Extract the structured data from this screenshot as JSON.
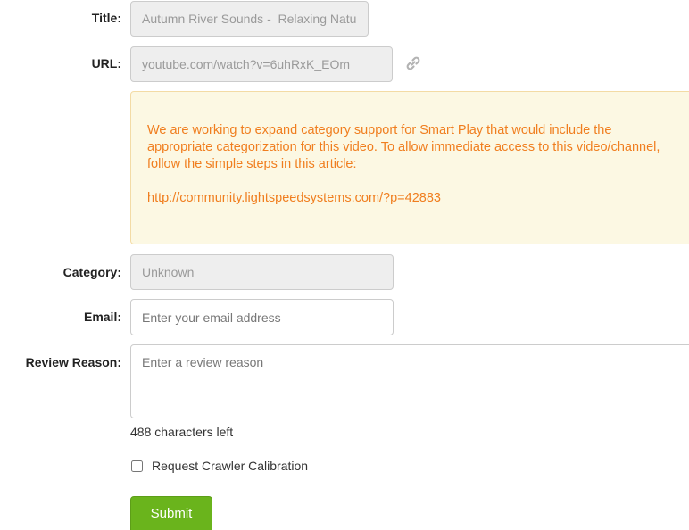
{
  "form": {
    "title_label": "Title:",
    "title_value": "Autumn River Sounds -  Relaxing Natu",
    "url_label": "URL:",
    "url_value": "youtube.com/watch?v=6uhRxK_EOm",
    "link_icon": "link-icon",
    "notice": {
      "text": "We are working to expand category support for Smart Play that would include the appropriate categorization for this video. To allow immediate access to this video/channel, follow the simple steps in this article:",
      "link": "http://community.lightspeedsystems.com/?p=42883"
    },
    "category_label": "Category:",
    "category_value": "Unknown",
    "email_label": "Email:",
    "email_placeholder": "Enter your email address",
    "reason_label": "Review Reason:",
    "reason_placeholder": "Enter a review reason",
    "characters_left": "488 characters left",
    "crawler_label": "Request Crawler Calibration",
    "crawler_checked": false,
    "submit_label": "Submit"
  },
  "colors": {
    "notice_text": "#f07e1f",
    "notice_background": "#fcf8e3",
    "submit_background": "#6ab41c"
  }
}
